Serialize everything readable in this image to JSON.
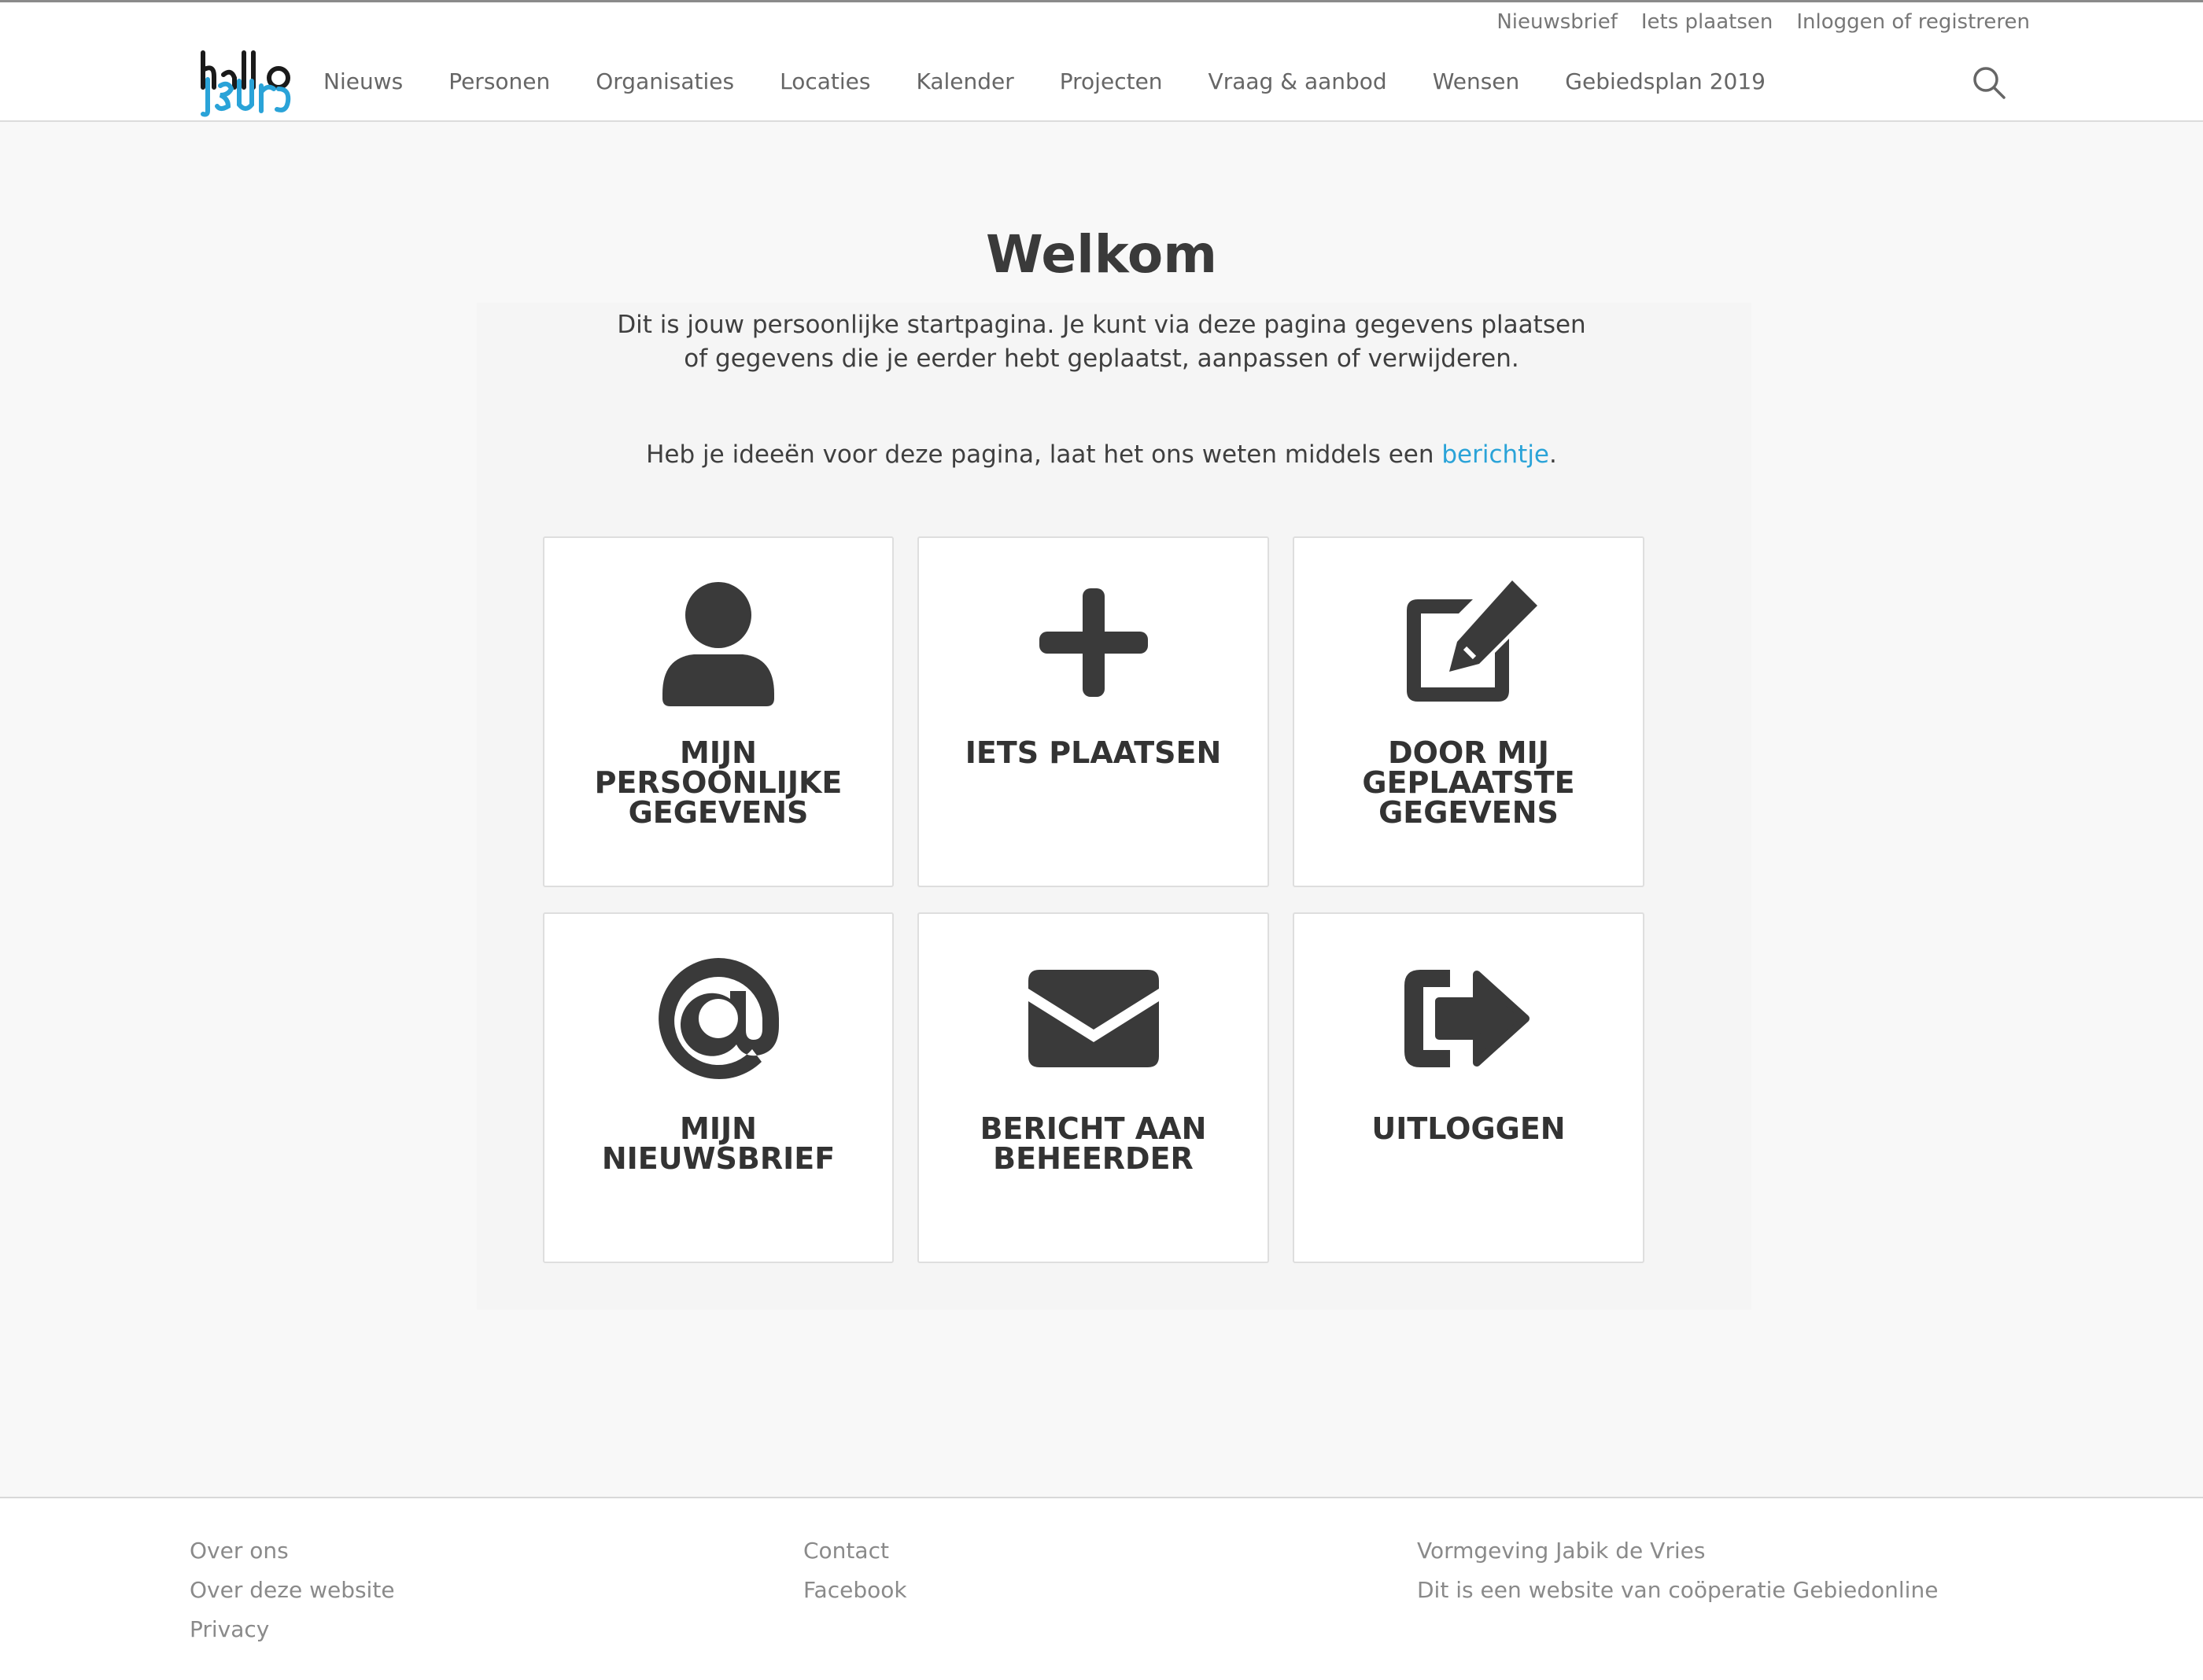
{
  "topbar": {
    "items": [
      "Nieuwsbrief",
      "Iets plaatsen",
      "Inloggen of registreren"
    ]
  },
  "logo": {
    "name": "hallo-ijsburg-logo"
  },
  "nav": {
    "items": [
      "Nieuws",
      "Personen",
      "Organisaties",
      "Locaties",
      "Kalender",
      "Projecten",
      "Vraag & aanbod",
      "Wensen",
      "Gebiedsplan 2019"
    ],
    "search_icon": "search-icon"
  },
  "main": {
    "title": "Welkom",
    "intro_line1": "Dit is jouw persoonlijke startpagina. Je kunt via deze pagina gegevens plaatsen",
    "intro_line2": "of gegevens die je eerder hebt geplaatst, aanpassen of verwijderen.",
    "feedback_text": "Heb je ideeën voor deze pagina, laat het ons weten middels een ",
    "feedback_link": "berichtje",
    "feedback_end": "."
  },
  "tiles": [
    {
      "label": "Mijn persoonlijke gegevens",
      "icon": "user-icon"
    },
    {
      "label": "Iets plaatsen",
      "icon": "plus-icon"
    },
    {
      "label": "Door mij geplaatste gegevens",
      "icon": "edit-icon"
    },
    {
      "label": "Mijn nieuwsbrief",
      "icon": "at-icon"
    },
    {
      "label": "Bericht aan beheerder",
      "icon": "envelope-icon"
    },
    {
      "label": "Uitloggen",
      "icon": "sign-out-icon"
    }
  ],
  "footer": {
    "col1": [
      "Over ons",
      "Over deze website",
      "Privacy"
    ],
    "col2": [
      "Contact",
      "Facebook"
    ],
    "col3": [
      "Vormgeving Jabik de Vries",
      "Dit is een website van coöperatie Gebiedonline"
    ]
  },
  "colors": {
    "accent": "#2aa3d8",
    "text": "#3a3a3a",
    "icon": "#3a3a3a",
    "background": "#f8f8f8"
  }
}
